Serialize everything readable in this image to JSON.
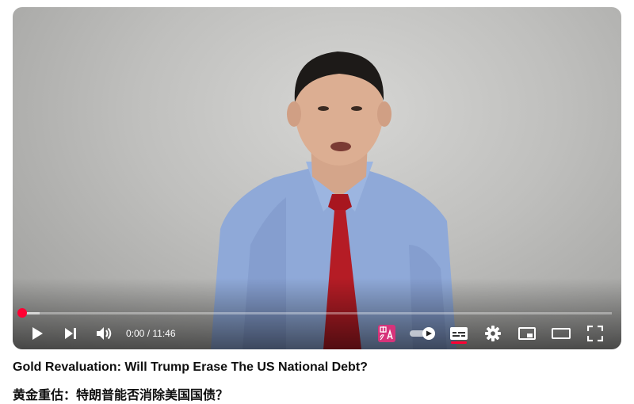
{
  "video": {
    "current_time": "0:00",
    "separator": " / ",
    "duration": "11:46",
    "progress_played_fraction": 0.0,
    "progress_loaded_fraction": 0.03,
    "autoplay_on": true,
    "subtitles_on": true
  },
  "controls": {
    "play_icon": "play-icon",
    "next_icon": "next-icon",
    "volume_icon": "volume-icon",
    "translate_icon": "translate-icon",
    "autoplay_icon": "autoplay-toggle-icon",
    "subtitles_icon": "subtitles-icon",
    "settings_icon": "gear-icon",
    "miniplayer_icon": "miniplayer-icon",
    "theater_icon": "theater-mode-icon",
    "fullscreen_icon": "fullscreen-icon"
  },
  "titles": {
    "english": "Gold Revaluation: Will Trump Erase The US National Debt?",
    "chinese": "黄金重估：特朗普能否消除美国国债？"
  },
  "colors": {
    "accent": "#ff0033",
    "translate_badge": "#d6337a",
    "title_text": "#0f0f0f"
  }
}
